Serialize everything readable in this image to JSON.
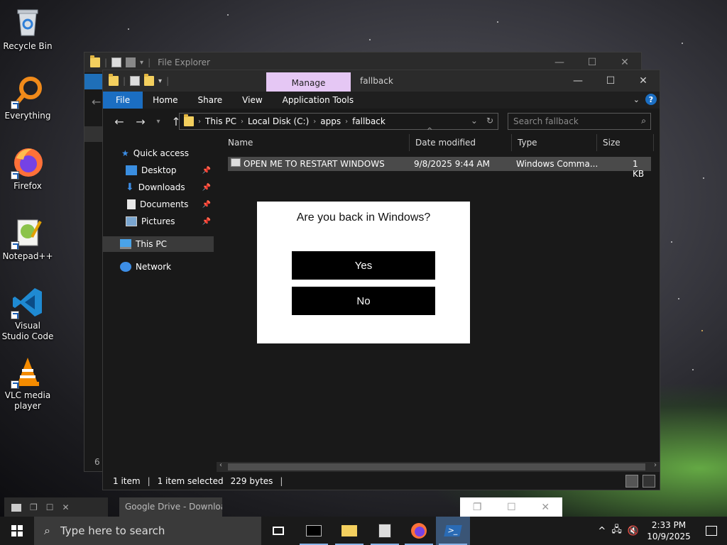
{
  "desktop": {
    "icons": [
      {
        "label": "Recycle Bin",
        "icon": "recycle-bin-icon"
      },
      {
        "label": "Everything",
        "icon": "everything-search-icon"
      },
      {
        "label": "Firefox",
        "icon": "firefox-icon"
      },
      {
        "label": "Notepad++",
        "icon": "notepad-plus-plus-icon"
      },
      {
        "label": "Visual Studio Code",
        "icon": "vscode-icon"
      },
      {
        "label": "VLC media player",
        "icon": "vlc-icon"
      }
    ]
  },
  "back_window": {
    "title": "File Explorer",
    "status_count": "6 i"
  },
  "explorer": {
    "manage_tab": "Manage",
    "folder_title": "fallback",
    "ribbon_tabs": [
      "File",
      "Home",
      "Share",
      "View",
      "Application Tools"
    ],
    "breadcrumb": [
      "This PC",
      "Local Disk (C:)",
      "apps",
      "fallback"
    ],
    "search_placeholder": "Search fallback",
    "sidebar": {
      "quick_access": "Quick access",
      "desktop": "Desktop",
      "downloads": "Downloads",
      "documents": "Documents",
      "pictures": "Pictures",
      "this_pc": "This PC",
      "network": "Network"
    },
    "columns": [
      "Name",
      "Date modified",
      "Type",
      "Size"
    ],
    "files": [
      {
        "name": "OPEN ME TO RESTART WINDOWS",
        "date": "9/8/2025 9:44 AM",
        "type": "Windows Comma...",
        "size": "1 KB"
      }
    ],
    "status": {
      "items": "1 item",
      "selected": "1 item selected",
      "size": "229 bytes"
    }
  },
  "dialog": {
    "question": "Are you back in Windows?",
    "yes": "Yes",
    "no": "No"
  },
  "minimized": {
    "google_drive": "Google Drive - Downloa..."
  },
  "taskbar": {
    "search_placeholder": "Type here to search",
    "apps": [
      "task-view-icon",
      "terminal-icon",
      "file-explorer-icon",
      "media-player-icon",
      "firefox-icon",
      "powershell-icon"
    ],
    "time": "2:33 PM",
    "date": "10/9/2025"
  },
  "colors": {
    "accent": "#1b6ec2",
    "manage_tab": "#e5c7f4",
    "dialog_bg": "#ffffff",
    "dialog_button": "#000000"
  }
}
